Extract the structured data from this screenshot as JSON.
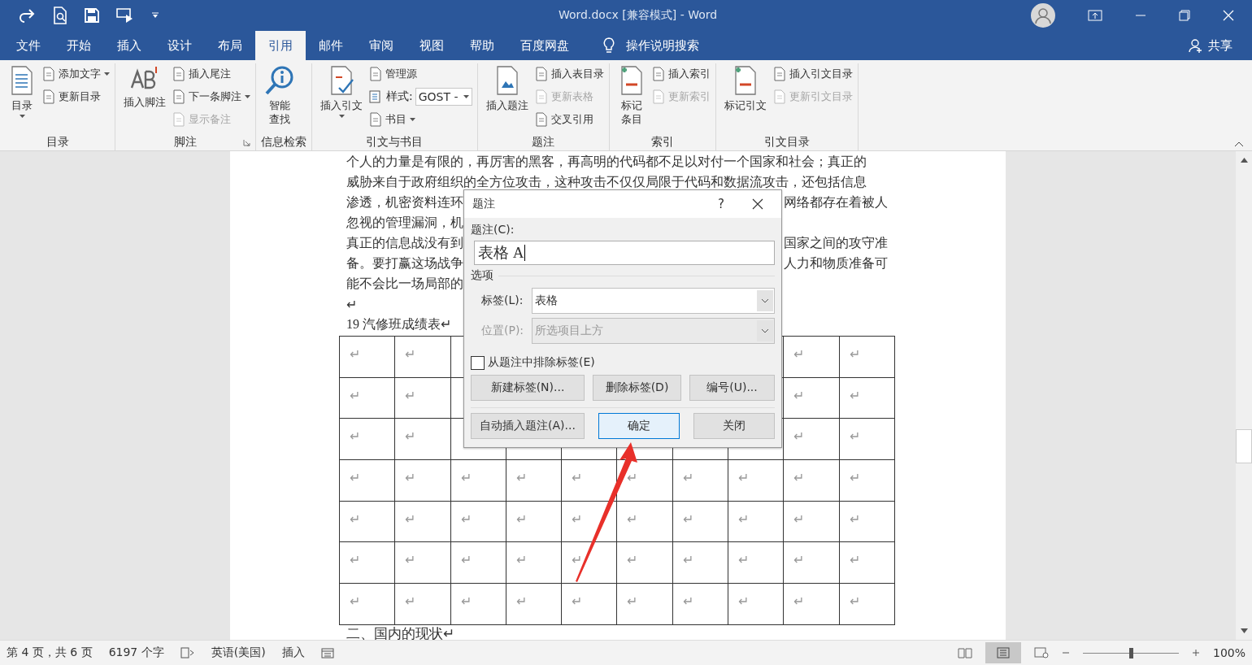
{
  "window": {
    "title": "Word.docx [兼容模式]  -  Word"
  },
  "menu_tabs": [
    {
      "label": "文件",
      "selected": false
    },
    {
      "label": "开始",
      "selected": false
    },
    {
      "label": "插入",
      "selected": false
    },
    {
      "label": "设计",
      "selected": false
    },
    {
      "label": "布局",
      "selected": false
    },
    {
      "label": "引用",
      "selected": true
    },
    {
      "label": "邮件",
      "selected": false
    },
    {
      "label": "审阅",
      "selected": false
    },
    {
      "label": "视图",
      "selected": false
    },
    {
      "label": "帮助",
      "selected": false
    },
    {
      "label": "百度网盘",
      "selected": false
    }
  ],
  "tell_me": "操作说明搜索",
  "share": "共享",
  "ribbon_groups": [
    {
      "label": "目录",
      "launcher": false,
      "large": [
        {
          "label": "目录",
          "has_menu": true
        }
      ],
      "small": [
        {
          "kind": "button",
          "label": "添加文字",
          "has_menu": true,
          "disabled": false
        },
        {
          "kind": "button",
          "label": "更新目录",
          "has_menu": false,
          "disabled": false
        }
      ]
    },
    {
      "label": "脚注",
      "launcher": true,
      "large": [
        {
          "label": "插入脚注",
          "has_menu": false
        }
      ],
      "small": [
        {
          "kind": "button",
          "label": "插入尾注",
          "has_menu": false,
          "disabled": false
        },
        {
          "kind": "button",
          "label": "下一条脚注",
          "has_menu": true,
          "disabled": false
        },
        {
          "kind": "button",
          "label": "显示备注",
          "has_menu": false,
          "disabled": true
        }
      ]
    },
    {
      "label": "信息检索",
      "launcher": false,
      "large": [
        {
          "label": "智能查找",
          "has_menu": false
        }
      ]
    },
    {
      "label": "引文与书目",
      "launcher": false,
      "large": [
        {
          "label": "插入引文",
          "has_menu": true
        }
      ],
      "small": [
        {
          "kind": "button",
          "label": "管理源",
          "has_menu": false,
          "disabled": false
        },
        {
          "kind": "select",
          "label": "样式:",
          "value": "GOST -",
          "has_menu": true
        },
        {
          "kind": "button",
          "label": "书目",
          "has_menu": true,
          "disabled": false
        }
      ]
    },
    {
      "label": "题注",
      "launcher": false,
      "large": [
        {
          "label": "插入题注",
          "has_menu": false
        }
      ],
      "small": [
        {
          "kind": "button",
          "label": "插入表目录",
          "has_menu": false,
          "disabled": false
        },
        {
          "kind": "button",
          "label": "更新表格",
          "has_menu": false,
          "disabled": true
        },
        {
          "kind": "button",
          "label": "交叉引用",
          "has_menu": false,
          "disabled": false
        }
      ]
    },
    {
      "label": "索引",
      "launcher": false,
      "large": [
        {
          "label": "标记条目",
          "has_menu": false
        }
      ],
      "small": [
        {
          "kind": "button",
          "label": "插入索引",
          "has_menu": false,
          "disabled": false
        },
        {
          "kind": "button",
          "label": "更新索引",
          "has_menu": false,
          "disabled": true
        }
      ]
    },
    {
      "label": "引文目录",
      "launcher": false,
      "large": [
        {
          "label": "标记引文",
          "has_menu": false
        }
      ],
      "small": [
        {
          "kind": "button",
          "label": "插入引文目录",
          "has_menu": false,
          "disabled": false
        },
        {
          "kind": "button",
          "label": "更新引文目录",
          "has_menu": false,
          "disabled": true
        }
      ]
    }
  ],
  "document": {
    "lines": [
      {
        "left": "个人的力量是有限的，再厉害的黑客，再高明的代码都不足以对付一个国家和社会；真正的"
      },
      {
        "left": "威胁来自于政府组织的全方位攻击，这种攻击不仅仅局限于代码和数据流攻击，还包括信息"
      },
      {
        "left": "渗透，机密资料连环",
        "right": "网络都存在着被人"
      },
      {
        "left": "忽视的管理漏洞，机"
      },
      {
        "left": "真正的信息战没有到",
        "right": "国家之间的攻守准"
      },
      {
        "left": "备。要打赢这场战争",
        "right": "人力和物质准备可"
      },
      {
        "left": "能不会比一场局部的"
      },
      {
        "left": "↵"
      }
    ],
    "caption": "19 汽修班成绩表↵",
    "table_rows": [
      {
        "left": [
          "↵",
          "↵"
        ],
        "right": [
          "↵",
          "↵"
        ]
      },
      {
        "left": [
          "↵",
          "↵"
        ],
        "right": [
          "↵",
          "↵"
        ]
      },
      {
        "left": [
          "↵",
          "↵"
        ],
        "right": [
          "↵",
          "↵"
        ]
      },
      {
        "cells": [
          "↵",
          "↵",
          "↵",
          "↵",
          "↵",
          "↵",
          "↵",
          "↵",
          "↵",
          "↵"
        ]
      },
      {
        "cells": [
          "↵",
          "↵",
          "↵",
          "↵",
          "↵",
          "↵",
          "↵",
          "↵",
          "↵",
          "↵"
        ]
      },
      {
        "cells": [
          "↵",
          "↵",
          "↵",
          "↵",
          "↵",
          "↵",
          "↵",
          "↵",
          "↵",
          "↵"
        ]
      },
      {
        "cells": [
          "↵",
          "↵",
          "↵",
          "↵",
          "↵",
          "↵",
          "↵",
          "↵",
          "↵",
          "↵"
        ]
      }
    ],
    "heading": "二、国内的现状↵"
  },
  "dialog": {
    "title": "题注",
    "help": "?",
    "caption_label": "题注(C):",
    "caption_value": "表格 A",
    "options_label": "选项",
    "fields": [
      {
        "label": "标签(L):",
        "value": "表格",
        "disabled": false
      },
      {
        "label": "位置(P):",
        "value": "所选项目上方",
        "disabled": true
      }
    ],
    "exclude_label": {
      "label": "从题注中排除标签(E)",
      "checked": false
    },
    "buttons_row1": [
      "新建标签(N)...",
      "删除标签(D)",
      "编号(U)..."
    ],
    "buttons_row2": [
      {
        "label": "自动插入题注(A)...",
        "default": false
      },
      {
        "label": "确定",
        "default": true
      },
      {
        "label": "关闭",
        "default": false
      }
    ]
  },
  "status_bar": {
    "page": "第 4 页，共 6 页",
    "words": "6197 个字",
    "language": "英语(美国)",
    "mode": "插入",
    "zoom": {
      "level": 0.5,
      "reading": "100%"
    }
  }
}
